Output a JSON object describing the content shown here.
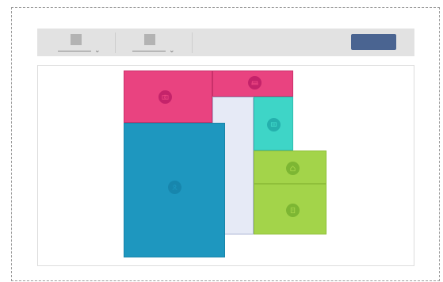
{
  "toolbar": {
    "tool_1": {
      "selected_value": ""
    },
    "tool_2": {
      "selected_value": ""
    },
    "action_button_label": ""
  },
  "floor_plan": {
    "rooms": [
      {
        "id": "room-top-left",
        "color": "#e94380",
        "icon": "camera-icon"
      },
      {
        "id": "room-top-right",
        "color": "#e94380",
        "icon": "sofa-icon"
      },
      {
        "id": "room-teal",
        "color": "#3ed5c7",
        "icon": "monitor-icon"
      },
      {
        "id": "room-blue",
        "color": "#1e97bf",
        "icon": "person-icon"
      },
      {
        "id": "room-lavender",
        "color": "#e6eaf6",
        "icon": ""
      },
      {
        "id": "room-green-top",
        "color": "#a3d44a",
        "icon": "home-icon"
      },
      {
        "id": "room-green-bottom",
        "color": "#a3d44a",
        "icon": "building-icon"
      }
    ]
  }
}
